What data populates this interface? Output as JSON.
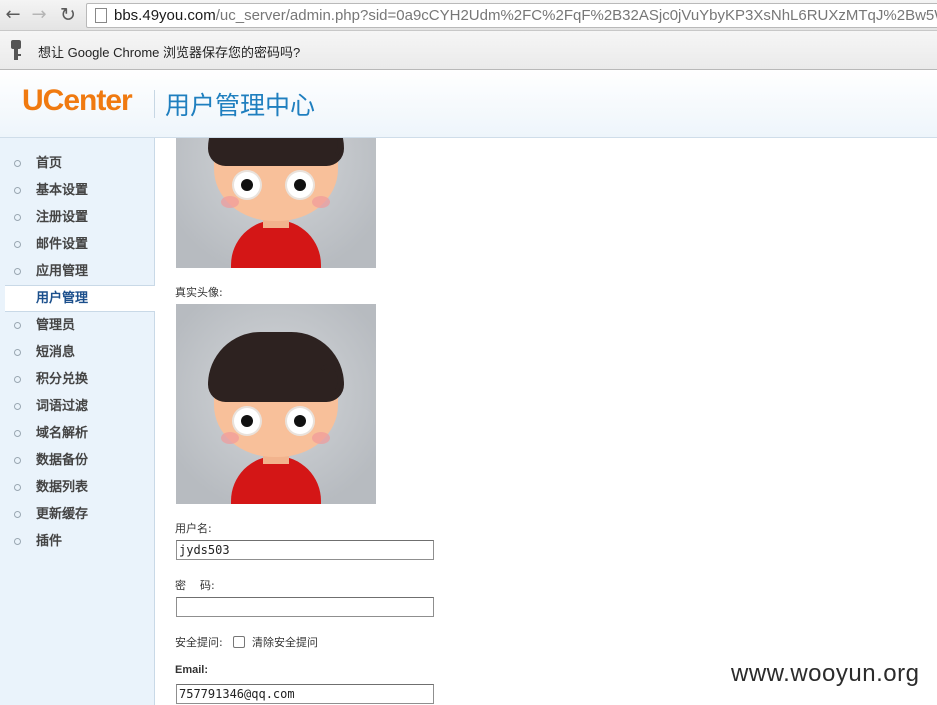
{
  "browser": {
    "url_host": "bbs.49you.com",
    "url_path": "/uc_server/admin.php?sid=0a9cCYH2Udm%2FC%2FqF%2B32ASjc0jVuYbyKP3XsNhL6RUXzMTqJ%2Bw5WNj6",
    "infobar_text": "想让 Google Chrome 浏览器保存您的密码吗?"
  },
  "header": {
    "logo": "UCenter",
    "title": "用户管理中心"
  },
  "sidebar": {
    "items": [
      {
        "label": "首页"
      },
      {
        "label": "基本设置"
      },
      {
        "label": "注册设置"
      },
      {
        "label": "邮件设置"
      },
      {
        "label": "应用管理"
      },
      {
        "label": "用户管理",
        "active": true
      },
      {
        "label": "管理员"
      },
      {
        "label": "短消息"
      },
      {
        "label": "积分兑换"
      },
      {
        "label": "词语过滤"
      },
      {
        "label": "域名解析"
      },
      {
        "label": "数据备份"
      },
      {
        "label": "数据列表"
      },
      {
        "label": "更新缓存"
      },
      {
        "label": "插件"
      }
    ]
  },
  "form": {
    "real_avatar_label": "真实头像:",
    "username_label": "用户名:",
    "username_value": "jyds503",
    "password_label": "密    码:",
    "password_value": "",
    "security_label": "安全提问:",
    "clear_security_label": "清除安全提问",
    "email_label": "Email:",
    "email_value": "757791346@qq.com"
  },
  "watermark": "www.wooyun.org"
}
